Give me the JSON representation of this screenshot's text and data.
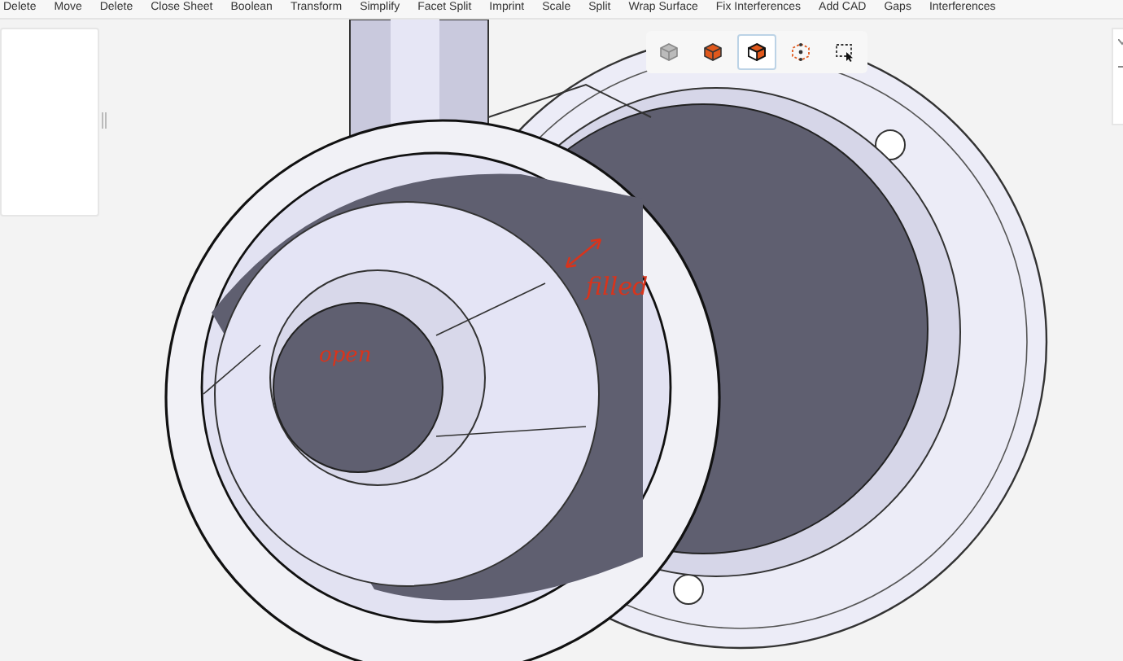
{
  "toolbar": [
    {
      "label": "Delete"
    },
    {
      "label": "Move"
    },
    {
      "label": "Delete"
    },
    {
      "label": "Close Sheet"
    },
    {
      "label": "Boolean"
    },
    {
      "label": "Transform"
    },
    {
      "label": "Simplify"
    },
    {
      "label": "Facet Split"
    },
    {
      "label": "Imprint"
    },
    {
      "label": "Scale"
    },
    {
      "label": "Split"
    },
    {
      "label": "Wrap Surface"
    },
    {
      "label": "Fix Interferences"
    },
    {
      "label": "Add CAD"
    },
    {
      "label": "Gaps"
    },
    {
      "label": "Interferences"
    }
  ],
  "view_buttons": [
    {
      "kind": "shaded",
      "selected": false
    },
    {
      "kind": "solid",
      "selected": false
    },
    {
      "kind": "edges",
      "selected": true
    },
    {
      "kind": "points",
      "selected": false
    },
    {
      "kind": "select",
      "selected": false
    }
  ],
  "annotations": [
    {
      "kind": "arrow-label",
      "text": "filled"
    },
    {
      "kind": "label",
      "text": "open"
    }
  ]
}
